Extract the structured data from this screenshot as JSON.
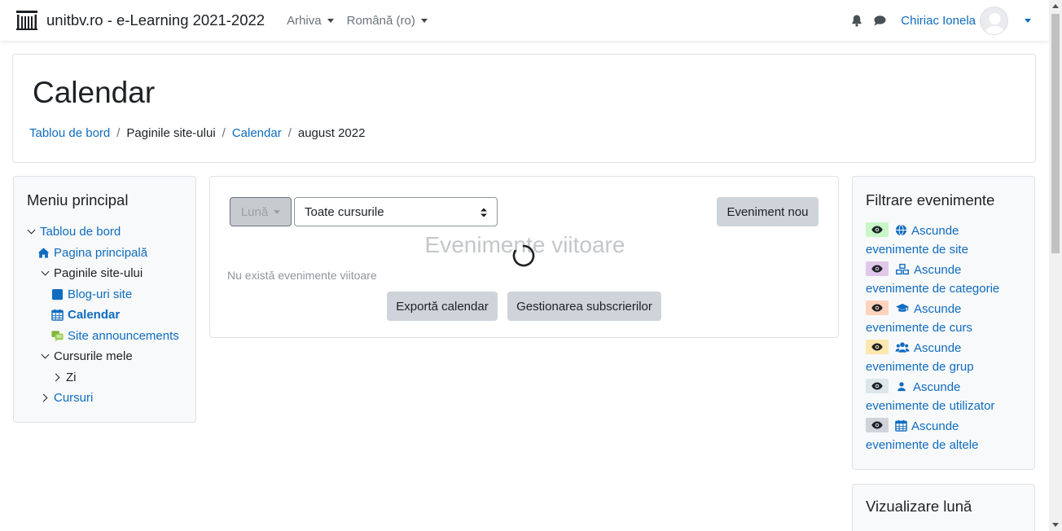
{
  "navbar": {
    "site_name": "unitbv.ro - e-Learning 2021-2022",
    "menu_archive": "Arhiva",
    "menu_language": "Română (ro)",
    "user_name": "Chiriac Ionela"
  },
  "header": {
    "title": "Calendar",
    "breadcrumb": [
      "Tablou de bord",
      "Paginile site-ului",
      "Calendar",
      "august 2022"
    ]
  },
  "main_menu": {
    "title": "Meniu principal",
    "items": [
      {
        "label": "Tablou de bord"
      },
      {
        "label": "Pagina principală"
      },
      {
        "label": "Paginile site-ului"
      },
      {
        "label": "Blog-uri site"
      },
      {
        "label": "Calendar"
      },
      {
        "label": "Site announcements"
      },
      {
        "label": "Cursurile mele"
      },
      {
        "label": "Zi"
      },
      {
        "label": "Cursuri"
      }
    ]
  },
  "calendar": {
    "view_button": "Lună",
    "course_select": "Toate cursurile",
    "new_event_button": "Eveniment nou",
    "upcoming_title": "Evenimente viitoare",
    "no_events": "Nu există evenimente viitoare",
    "export_button": "Exportă calendar",
    "manage_subscriptions_button": "Gestionarea subscrierilor"
  },
  "filter": {
    "title": "Filtrare evenimente",
    "hide_label": "Ascunde",
    "items": [
      {
        "line2": "evenimente de site",
        "color": "#c8f7c8",
        "icon": "globe-icon"
      },
      {
        "line2": "evenimente de categorie",
        "color": "#e1c7e9",
        "icon": "cubes-icon"
      },
      {
        "line2": "evenimente de curs",
        "color": "#ffd3bd",
        "icon": "graduation-cap-icon"
      },
      {
        "line2": "evenimente de grup",
        "color": "#fee7ae",
        "icon": "users-icon"
      },
      {
        "line2": "evenimente de utilizator",
        "color": "#dce7ec",
        "icon": "user-icon"
      },
      {
        "line2": "evenimente de altele",
        "color": "#ced4da",
        "icon": "calendar-icon"
      }
    ]
  },
  "month_block": {
    "title": "Vizualizare lună"
  }
}
